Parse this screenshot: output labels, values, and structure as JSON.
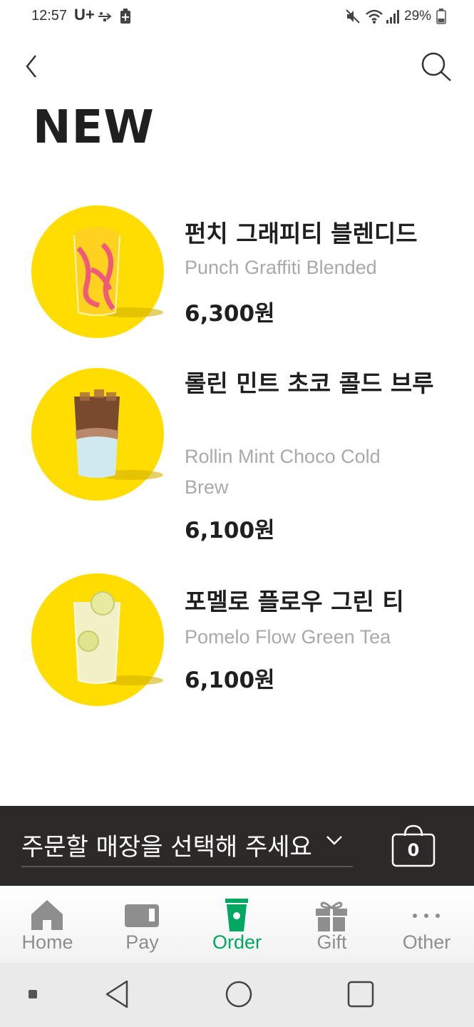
{
  "status_bar": {
    "time": "12:57",
    "carrier": "U+",
    "battery": "29%"
  },
  "header": {
    "title": "NEW"
  },
  "products": [
    {
      "name_ko": "펀치 그래피티 블렌디드",
      "name_en": "Punch Graffiti Blended",
      "price": "6,300원"
    },
    {
      "name_ko": "롤린 민트 초코 콜드 브루",
      "name_en": "Rollin Mint Choco Cold Brew",
      "price": "6,100원"
    },
    {
      "name_ko": "포멜로 플로우 그린 티",
      "name_en": "Pomelo Flow Green Tea",
      "price": "6,100원"
    }
  ],
  "store_selector": {
    "label": "주문할 매장을 선택해 주세요",
    "cart_count": "0"
  },
  "tabs": [
    {
      "label": "Home",
      "icon": "home-icon"
    },
    {
      "label": "Pay",
      "icon": "card-icon"
    },
    {
      "label": "Order",
      "icon": "cup-icon"
    },
    {
      "label": "Gift",
      "icon": "gift-icon"
    },
    {
      "label": "Other",
      "icon": "more-icon"
    }
  ],
  "colors": {
    "accent": "#00a862",
    "thumb_bg": "#ffdd00",
    "store_bar_bg": "#2c2a29"
  }
}
